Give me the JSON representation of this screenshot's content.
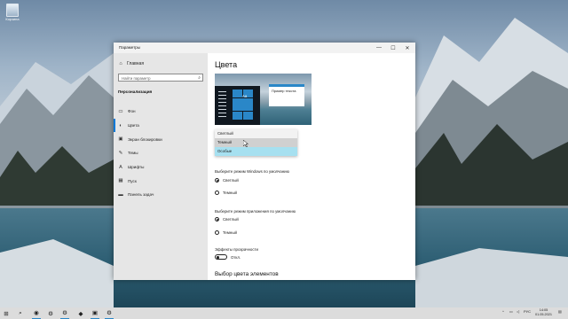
{
  "desktop": {
    "recycle_bin": {
      "label": "Корзина"
    }
  },
  "window": {
    "title": "Параметры",
    "controls": {
      "minimize": "—",
      "maximize": "☐",
      "close": "✕"
    },
    "sidebar": {
      "home": "Главная",
      "search_placeholder": "Найти параметр",
      "section": "Персонализация",
      "items": [
        {
          "label": "Фон",
          "icon": "image-icon"
        },
        {
          "label": "Цвета",
          "icon": "palette-icon",
          "active": true
        },
        {
          "label": "Экран блокировки",
          "icon": "lock-screen-icon"
        },
        {
          "label": "Темы",
          "icon": "brush-icon"
        },
        {
          "label": "Шрифты",
          "icon": "font-icon"
        },
        {
          "label": "Пуск",
          "icon": "start-icon"
        },
        {
          "label": "Панель задач",
          "icon": "taskbar-icon"
        }
      ]
    },
    "content": {
      "title": "Цвета",
      "preview": {
        "sample_text": "Пример текста",
        "tile_text": "Aa"
      },
      "color_dropdown": {
        "options": [
          "Светлый",
          "Темный",
          "Особые"
        ],
        "hovered": "Темный",
        "selected": "Особые"
      },
      "windows_mode": {
        "label": "Выберите режим Windows по умолчанию",
        "options": [
          "Светлый",
          "Темный"
        ],
        "selected": "Светлый"
      },
      "app_mode": {
        "label": "Выберите режим приложения по умолчанию",
        "options": [
          "Светлый",
          "Темный"
        ],
        "selected": "Светлый"
      },
      "transparency": {
        "label": "Эффекты прозрачности",
        "state": "Откл."
      },
      "accent_heading": "Выбор цвета элементов"
    }
  },
  "taskbar": {
    "apps": [
      "start-icon",
      "search-icon",
      "chrome-icon",
      "steam-icon",
      "steam-icon-2",
      "app-icon",
      "terminal-icon",
      "settings-icon"
    ],
    "tray": {
      "language": "РУС"
    },
    "clock": {
      "time": "14:05",
      "date": "01.05.2021"
    }
  }
}
